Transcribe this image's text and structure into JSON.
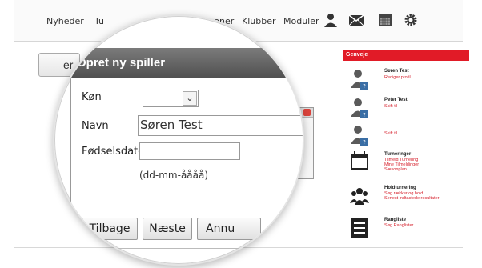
{
  "nav": {
    "items": [
      "Nyheder",
      "Tu",
      "Personer",
      "Klubber",
      "Moduler"
    ],
    "icons": [
      "person-icon",
      "mail-icon",
      "calendar-icon",
      "gear-icon"
    ]
  },
  "background": {
    "left_button": "er"
  },
  "dialog": {
    "title": "Opret ny spiller",
    "fields": {
      "gender_label": "Køn",
      "name_label": "Navn",
      "name_value": "Søren Test",
      "birthdate_label": "Fødselsdato",
      "birthdate_value": "",
      "date_hint": "(dd-mm-åååå)"
    },
    "buttons": {
      "back": "Tilbage",
      "next": "Næste",
      "cancel": "Annu"
    }
  },
  "shortcuts": {
    "title": "Genveje",
    "items": [
      {
        "icon": "user-icon",
        "title": "Søren Test",
        "links": [
          "Rediger profil"
        ]
      },
      {
        "icon": "user-icon",
        "title": "Peter Test",
        "links": [
          "Skift til"
        ]
      },
      {
        "icon": "user-icon",
        "title": "",
        "links": [
          "Skift til"
        ]
      },
      {
        "icon": "calendar-icon",
        "title": "Turneringer",
        "links": [
          "Tilmeld Turnering",
          "Mine Tilmeldinger",
          "Sæsonplan"
        ]
      },
      {
        "icon": "group-icon",
        "title": "Holdturnering",
        "links": [
          "Søg rækker og hold",
          "Senest indtastede resultater"
        ]
      },
      {
        "icon": "list-icon",
        "title": "Rangliste",
        "links": [
          "Søg Ranglister"
        ]
      }
    ]
  },
  "colors": {
    "accent_red": "#e11b27",
    "dialog_title_bg": "#5e5e5e"
  }
}
